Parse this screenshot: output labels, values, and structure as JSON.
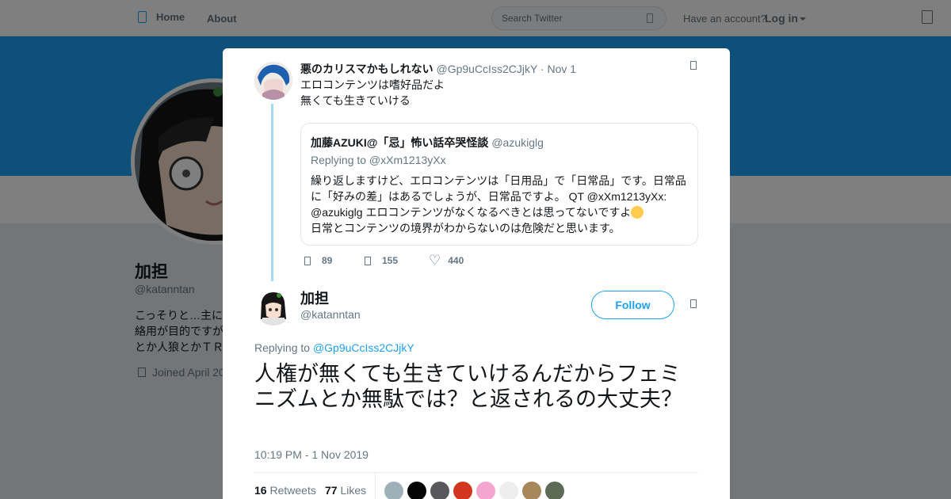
{
  "topnav": {
    "home": "Home",
    "about": "About",
    "search_placeholder": "Search Twitter",
    "account_prompt": "Have an account?",
    "login": "Log in"
  },
  "profile": {
    "name": "加担",
    "handle": "@katanntan",
    "bio": "こっそりと…主に\n絡用が目的ですが\nとか人狼とかＴＲ",
    "joined": "Joined April 20"
  },
  "ancestor": {
    "name": "悪のカリスマかもしれない",
    "handle": "@Gp9uCcIss2CJjkY",
    "dot": "·",
    "time": "Nov 1",
    "lines": [
      "エロコンテンツは嗜好品だよ",
      "無くても生きていける"
    ],
    "quote": {
      "name": "加藤AZUKI@「忌」怖い話卒哭怪談",
      "handle": "@azukiglg",
      "replying": "Replying to @xXm1213yXx",
      "line1": "繰り返しますけど、エロコンテンツは「日用品」で「日常品」です。日常品",
      "line2": "に「好みの差」はあるでしょうが、日常品ですよ。 QT @xXm1213yXx:",
      "line3": "@azukiglg エロコンテンツがなくなるべきとは思ってないですよ",
      "line4": "日常とコンテンツの境界がわからないのは危険だと思います。"
    },
    "stats": {
      "replies": "89",
      "retweets": "155",
      "likes": "440"
    }
  },
  "main": {
    "name": "加担",
    "handle": "@katanntan",
    "follow": "Follow",
    "replying_prefix": "Replying to",
    "replying_to": "@Gp9uCcIss2CJjkY",
    "text": "人権が無くても生きていけるんだからフェミニズムとか無駄では？と返されるの大丈夫？",
    "timestamp": "10:19 PM - 1 Nov 2019",
    "retweets_count": "16",
    "retweets_label": "Retweets",
    "likes_count": "77",
    "likes_label": "Likes"
  },
  "colors": {
    "accent": "#1da1f2",
    "conversation_line": "#a5d9f8",
    "likers": [
      "#9fb1b8",
      "#050505",
      "#59595c",
      "#d3361f",
      "#f3a6cf",
      "#eeeeee",
      "#a7875c",
      "#5d6b55",
      "#ffffff"
    ]
  }
}
